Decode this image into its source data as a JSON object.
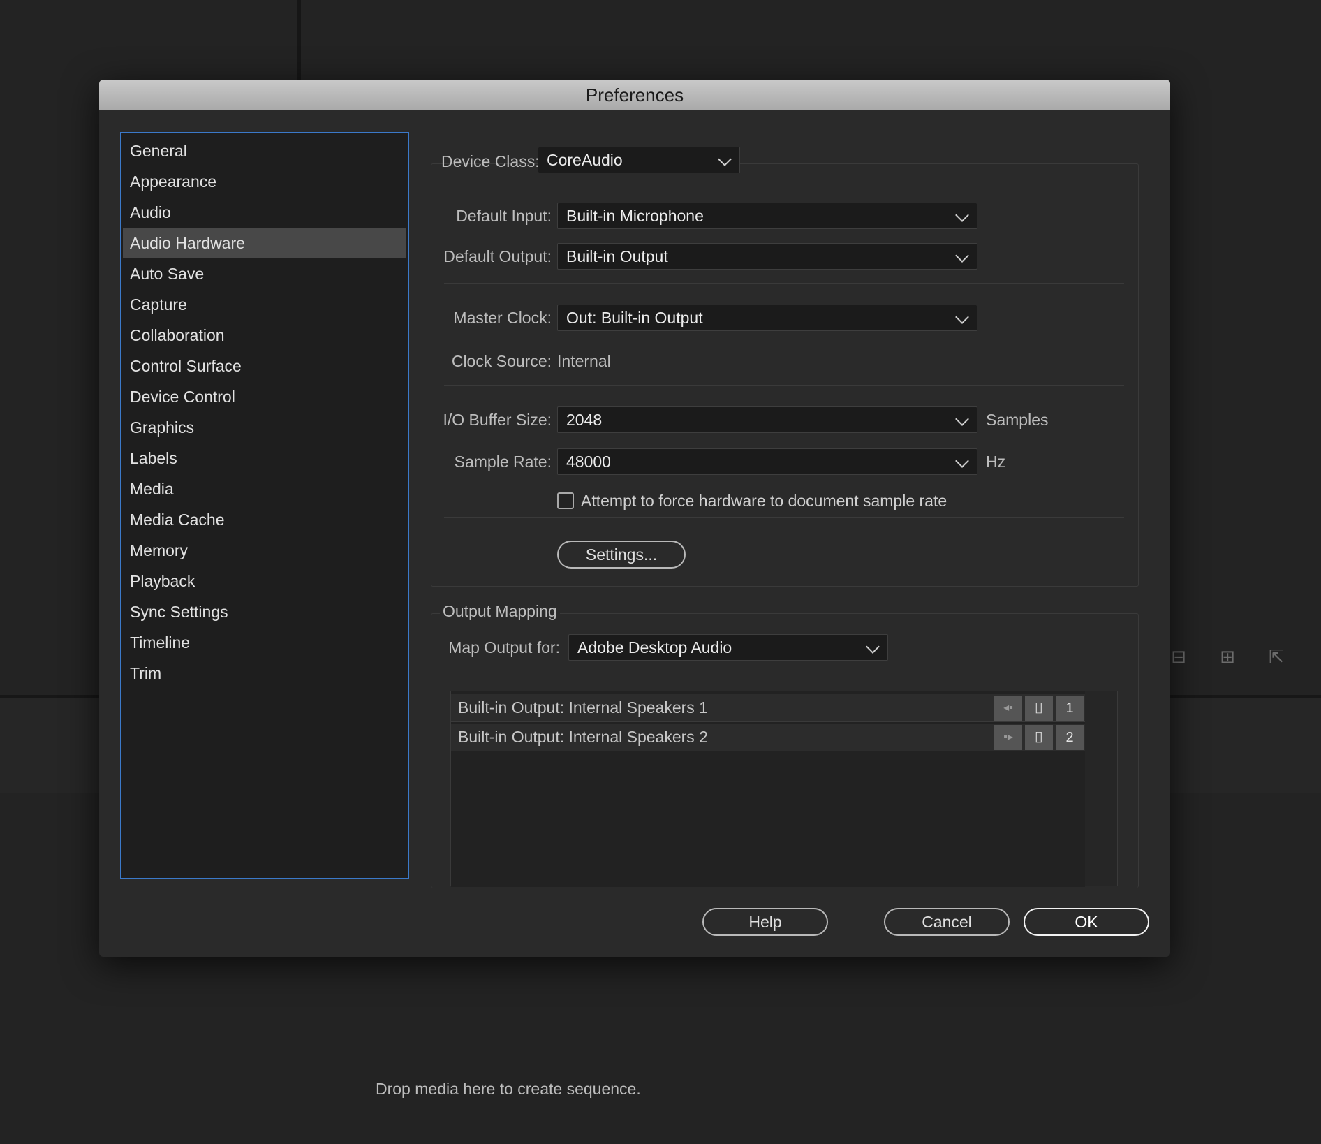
{
  "dialog": {
    "title": "Preferences"
  },
  "sidebar": {
    "items": [
      {
        "label": "General"
      },
      {
        "label": "Appearance"
      },
      {
        "label": "Audio"
      },
      {
        "label": "Audio Hardware",
        "selected": true
      },
      {
        "label": "Auto Save"
      },
      {
        "label": "Capture"
      },
      {
        "label": "Collaboration"
      },
      {
        "label": "Control Surface"
      },
      {
        "label": "Device Control"
      },
      {
        "label": "Graphics"
      },
      {
        "label": "Labels"
      },
      {
        "label": "Media"
      },
      {
        "label": "Media Cache"
      },
      {
        "label": "Memory"
      },
      {
        "label": "Playback"
      },
      {
        "label": "Sync Settings"
      },
      {
        "label": "Timeline"
      },
      {
        "label": "Trim"
      }
    ]
  },
  "audio_hardware": {
    "device_class_label": "Device Class:",
    "device_class_value": "CoreAudio",
    "default_input_label": "Default Input:",
    "default_input_value": "Built-in Microphone",
    "default_output_label": "Default Output:",
    "default_output_value": "Built-in Output",
    "master_clock_label": "Master Clock:",
    "master_clock_value": "Out: Built-in Output",
    "clock_source_label": "Clock Source:",
    "clock_source_value": "Internal",
    "buffer_size_label": "I/O Buffer Size:",
    "buffer_size_value": "2048",
    "buffer_size_unit": "Samples",
    "sample_rate_label": "Sample Rate:",
    "sample_rate_value": "48000",
    "sample_rate_unit": "Hz",
    "force_rate_label": "Attempt to force hardware to document sample rate",
    "force_rate_checked": false,
    "settings_button": "Settings..."
  },
  "output_mapping": {
    "title": "Output Mapping",
    "map_output_label": "Map Output for:",
    "map_output_value": "Adobe Desktop Audio",
    "rows": [
      {
        "label": "Built-in Output: Internal Speakers 1",
        "channel": "1"
      },
      {
        "label": "Built-in Output: Internal Speakers 2",
        "channel": "2"
      }
    ]
  },
  "buttons": {
    "help": "Help",
    "cancel": "Cancel",
    "ok": "OK"
  },
  "background": {
    "drop_hint": "Drop media here to create sequence."
  }
}
